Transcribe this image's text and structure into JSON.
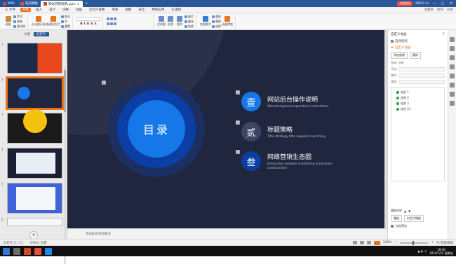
{
  "titlebar": {
    "tabs": [
      {
        "label": "WPS",
        "type": "app"
      },
      {
        "label": "稻壳模板",
        "type": "normal"
      },
      {
        "label": "网站营销策略.pptx",
        "type": "active"
      }
    ],
    "login_label": "访客登录",
    "right_texts": [
      "980.0 m"
    ],
    "winbtns": [
      "—",
      "▢",
      "✕"
    ]
  },
  "menubar": {
    "file": "三 文件",
    "start": "开始",
    "items": [
      "插入",
      "设计",
      "切换",
      "动画",
      "幻灯片放映",
      "审阅",
      "视图",
      "安全",
      "特色应用"
    ],
    "search": "Q 查找",
    "right": [
      "云服务",
      "协作",
      "分享"
    ]
  },
  "ribbon": {
    "paste": "粘贴",
    "cut": "剪切",
    "copy": "复制",
    "format_painter": "格式刷",
    "from_current": "从当前开始",
    "new_slide": "新建幻灯片",
    "layout": "版式",
    "section": "节",
    "reset": "重置",
    "font_value": "",
    "format_buttons": [
      "B",
      "I",
      "U",
      "S",
      "A"
    ],
    "textbox": "文本框",
    "shape": "形状",
    "arrange": "排列",
    "picture": "图片",
    "fill": "填充",
    "outline": "轮廓",
    "find": "查找",
    "replace": "替换",
    "select": "选择",
    "text_tools": "文档助手",
    "effects": "动画特效"
  },
  "leftpane": {
    "tabs": [
      "大纲",
      "幻灯片"
    ],
    "slide_numbers": [
      "1",
      "2",
      "3",
      "4",
      "5",
      "6"
    ]
  },
  "slide": {
    "center_title": "目录",
    "markers": [
      "0",
      "0",
      "0",
      "0"
    ],
    "items": [
      {
        "num": "壹",
        "title": "网站后台操作说明",
        "subtitle": "Site background operation instructions",
        "color": "#1677e8"
      },
      {
        "num": "贰",
        "title": "标题策略",
        "subtitle": "Title strategy title keyword summary",
        "color": "#3c4562"
      },
      {
        "num": "叁",
        "title": "网络营销生态圈",
        "subtitle": "Enterprise network marketing ecosystem construction",
        "color": "#0b3fa6"
      }
    ]
  },
  "notes": {
    "placeholder": "单击此处添加备注"
  },
  "rightpane": {
    "title": "自定义动画",
    "close": "×",
    "select_pane": "选择窗格",
    "custom_anim": "自定义动画",
    "add_effect": "添加效果",
    "delete": "删除",
    "modify_label": "修改: 效果",
    "fields": [
      {
        "label": "开始:"
      },
      {
        "label": "属性:"
      },
      {
        "label": "速度:"
      }
    ],
    "list": [
      "组合 1",
      "组合 2",
      "组合 3",
      "组合 21"
    ],
    "reorder_label": "重新排序",
    "play": "播放",
    "slideshow": "幻灯片播放",
    "autopreview": "自动预览"
  },
  "statusbar": {
    "slide_info": "幻灯片 2 / 11",
    "theme": "Office 主题",
    "zoom": "100%",
    "ai": "AI 智能排版"
  },
  "taskbar": {
    "time": "18:40",
    "date": "2019/7/12 星期五"
  },
  "colors": {
    "brand": "#2b579a",
    "accent": "#e8731c",
    "slide_bg": "#20263d"
  }
}
